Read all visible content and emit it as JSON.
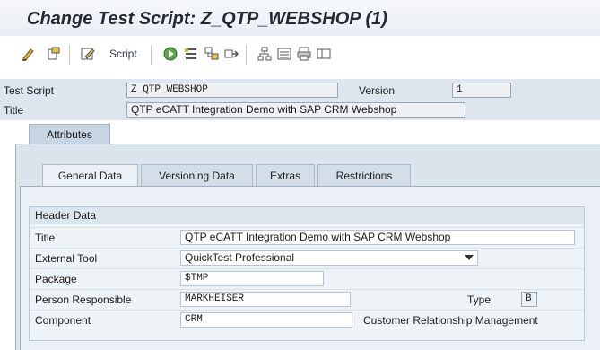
{
  "window": {
    "title": "Change Test Script: Z_QTP_WEBSHOP (1)"
  },
  "toolbar": {
    "script_label": "Script",
    "icons": [
      "display-change-icon",
      "other-object-icon",
      "edit-icon",
      "execute-icon",
      "pattern-icon",
      "structure-icon",
      "navigation-icon",
      "hierarchy-icon",
      "list-icon",
      "print-icon",
      "layout-icon"
    ]
  },
  "header": {
    "test_script_label": "Test Script",
    "test_script_value": "Z_QTP_WEBSHOP",
    "version_label": "Version",
    "version_value": "1",
    "title_label": "Title",
    "title_value": "QTP eCATT Integration Demo with SAP CRM Webshop"
  },
  "tabs": {
    "attributes": "Attributes"
  },
  "subtabs": [
    "General Data",
    "Versioning Data",
    "Extras",
    "Restrictions"
  ],
  "header_data": {
    "group_title": "Header Data",
    "title_label": "Title",
    "title_value": "QTP eCATT Integration Demo with SAP CRM Webshop",
    "external_tool_label": "External Tool",
    "external_tool_value": "QuickTest Professional",
    "package_label": "Package",
    "package_value": "$TMP",
    "person_label": "Person Responsible",
    "person_value": "MARKHEISER",
    "type_label": "Type",
    "type_value": "B",
    "component_label": "Component",
    "component_value": "CRM",
    "component_desc": "Customer Relationship Management"
  }
}
